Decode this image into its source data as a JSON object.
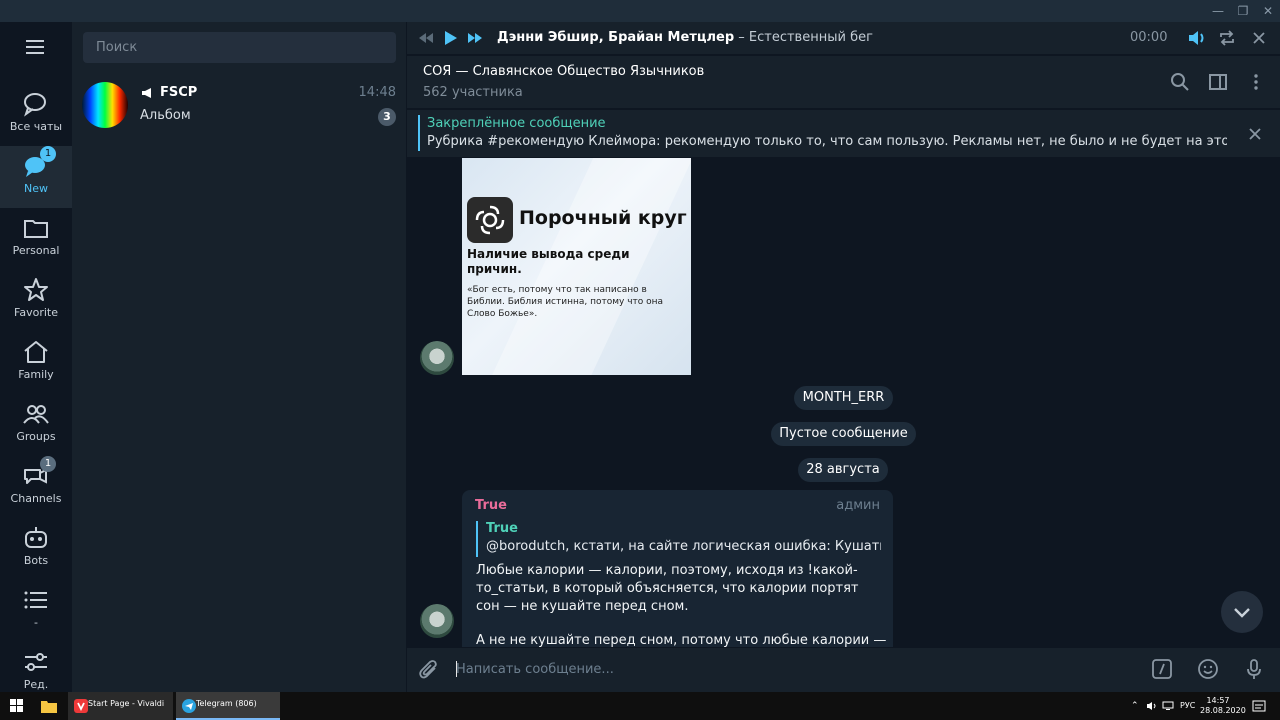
{
  "folders": [
    {
      "label": "Все чаты",
      "icon": "chats-icon",
      "badge": ""
    },
    {
      "label": "New",
      "icon": "new-chat-icon",
      "badge": "1"
    },
    {
      "label": "Personal",
      "icon": "folder-icon",
      "badge": ""
    },
    {
      "label": "Favorite",
      "icon": "star-icon",
      "badge": ""
    },
    {
      "label": "Family",
      "icon": "home-icon",
      "badge": ""
    },
    {
      "label": "Groups",
      "icon": "groups-icon",
      "badge": ""
    },
    {
      "label": "Channels",
      "icon": "channels-icon",
      "badge": "1"
    },
    {
      "label": "Bots",
      "icon": "bot-icon",
      "badge": ""
    },
    {
      "label": "-",
      "icon": "list-icon",
      "badge": ""
    },
    {
      "label": "Ред.",
      "icon": "edit-folders-icon",
      "badge": ""
    }
  ],
  "search": {
    "placeholder": "Поиск"
  },
  "chat_item": {
    "name": "FSCP",
    "time": "14:48",
    "preview": "Альбом",
    "unread": "3"
  },
  "player": {
    "artist": "Дэнни Эбшир, Брайан Метцлер",
    "separator": " – ",
    "track": "Естественный бег",
    "time": "00:00"
  },
  "channel": {
    "title": "СОЯ — Славянское Общество Язычников",
    "subtitle": "562 участника"
  },
  "pinned": {
    "title": "Закреплённое сообщение",
    "text": "Рубрика #рекомендую  Клеймора: рекомендую только то, что сам пользую. Рекламы нет, не было и не будет на этом канале...."
  },
  "image_card": {
    "brand": "Порочный круг",
    "heading": "Наличие вывода среди причин.",
    "quote": "«Бог есть, потому что так написано в Библии. Библия истинна, потому что она Слово Божье»."
  },
  "service_messages": [
    "MONTH_ERR",
    "Пустое сообщение",
    "28 августа"
  ],
  "message": {
    "author": "True",
    "role": "админ",
    "reply_author": "True",
    "reply_text": "@borodutch, кстати, на сайте логическая ошибка: Кушать не...",
    "body": "Любые калории — калории, поэтому, исходя из !какой-то_статьи, в который объясняется, что калории портят сон — не кушайте перед сном.",
    "body2": "А не не кушайте перед сном, потому что любые калории —"
  },
  "composer": {
    "placeholder": "Написать сообщение..."
  },
  "taskbar": {
    "apps": [
      {
        "label": "Start Page - Vivaldi"
      },
      {
        "label": "Telegram (806)"
      }
    ],
    "lang": "РУС",
    "time": "14:57",
    "date": "28.08.2020"
  },
  "colors": {
    "accent": "#4fc3f7",
    "sidebar": "#0e1621",
    "panel": "#17212b",
    "author_pink": "#e96c9a",
    "reply_green": "#4fd1b8"
  }
}
